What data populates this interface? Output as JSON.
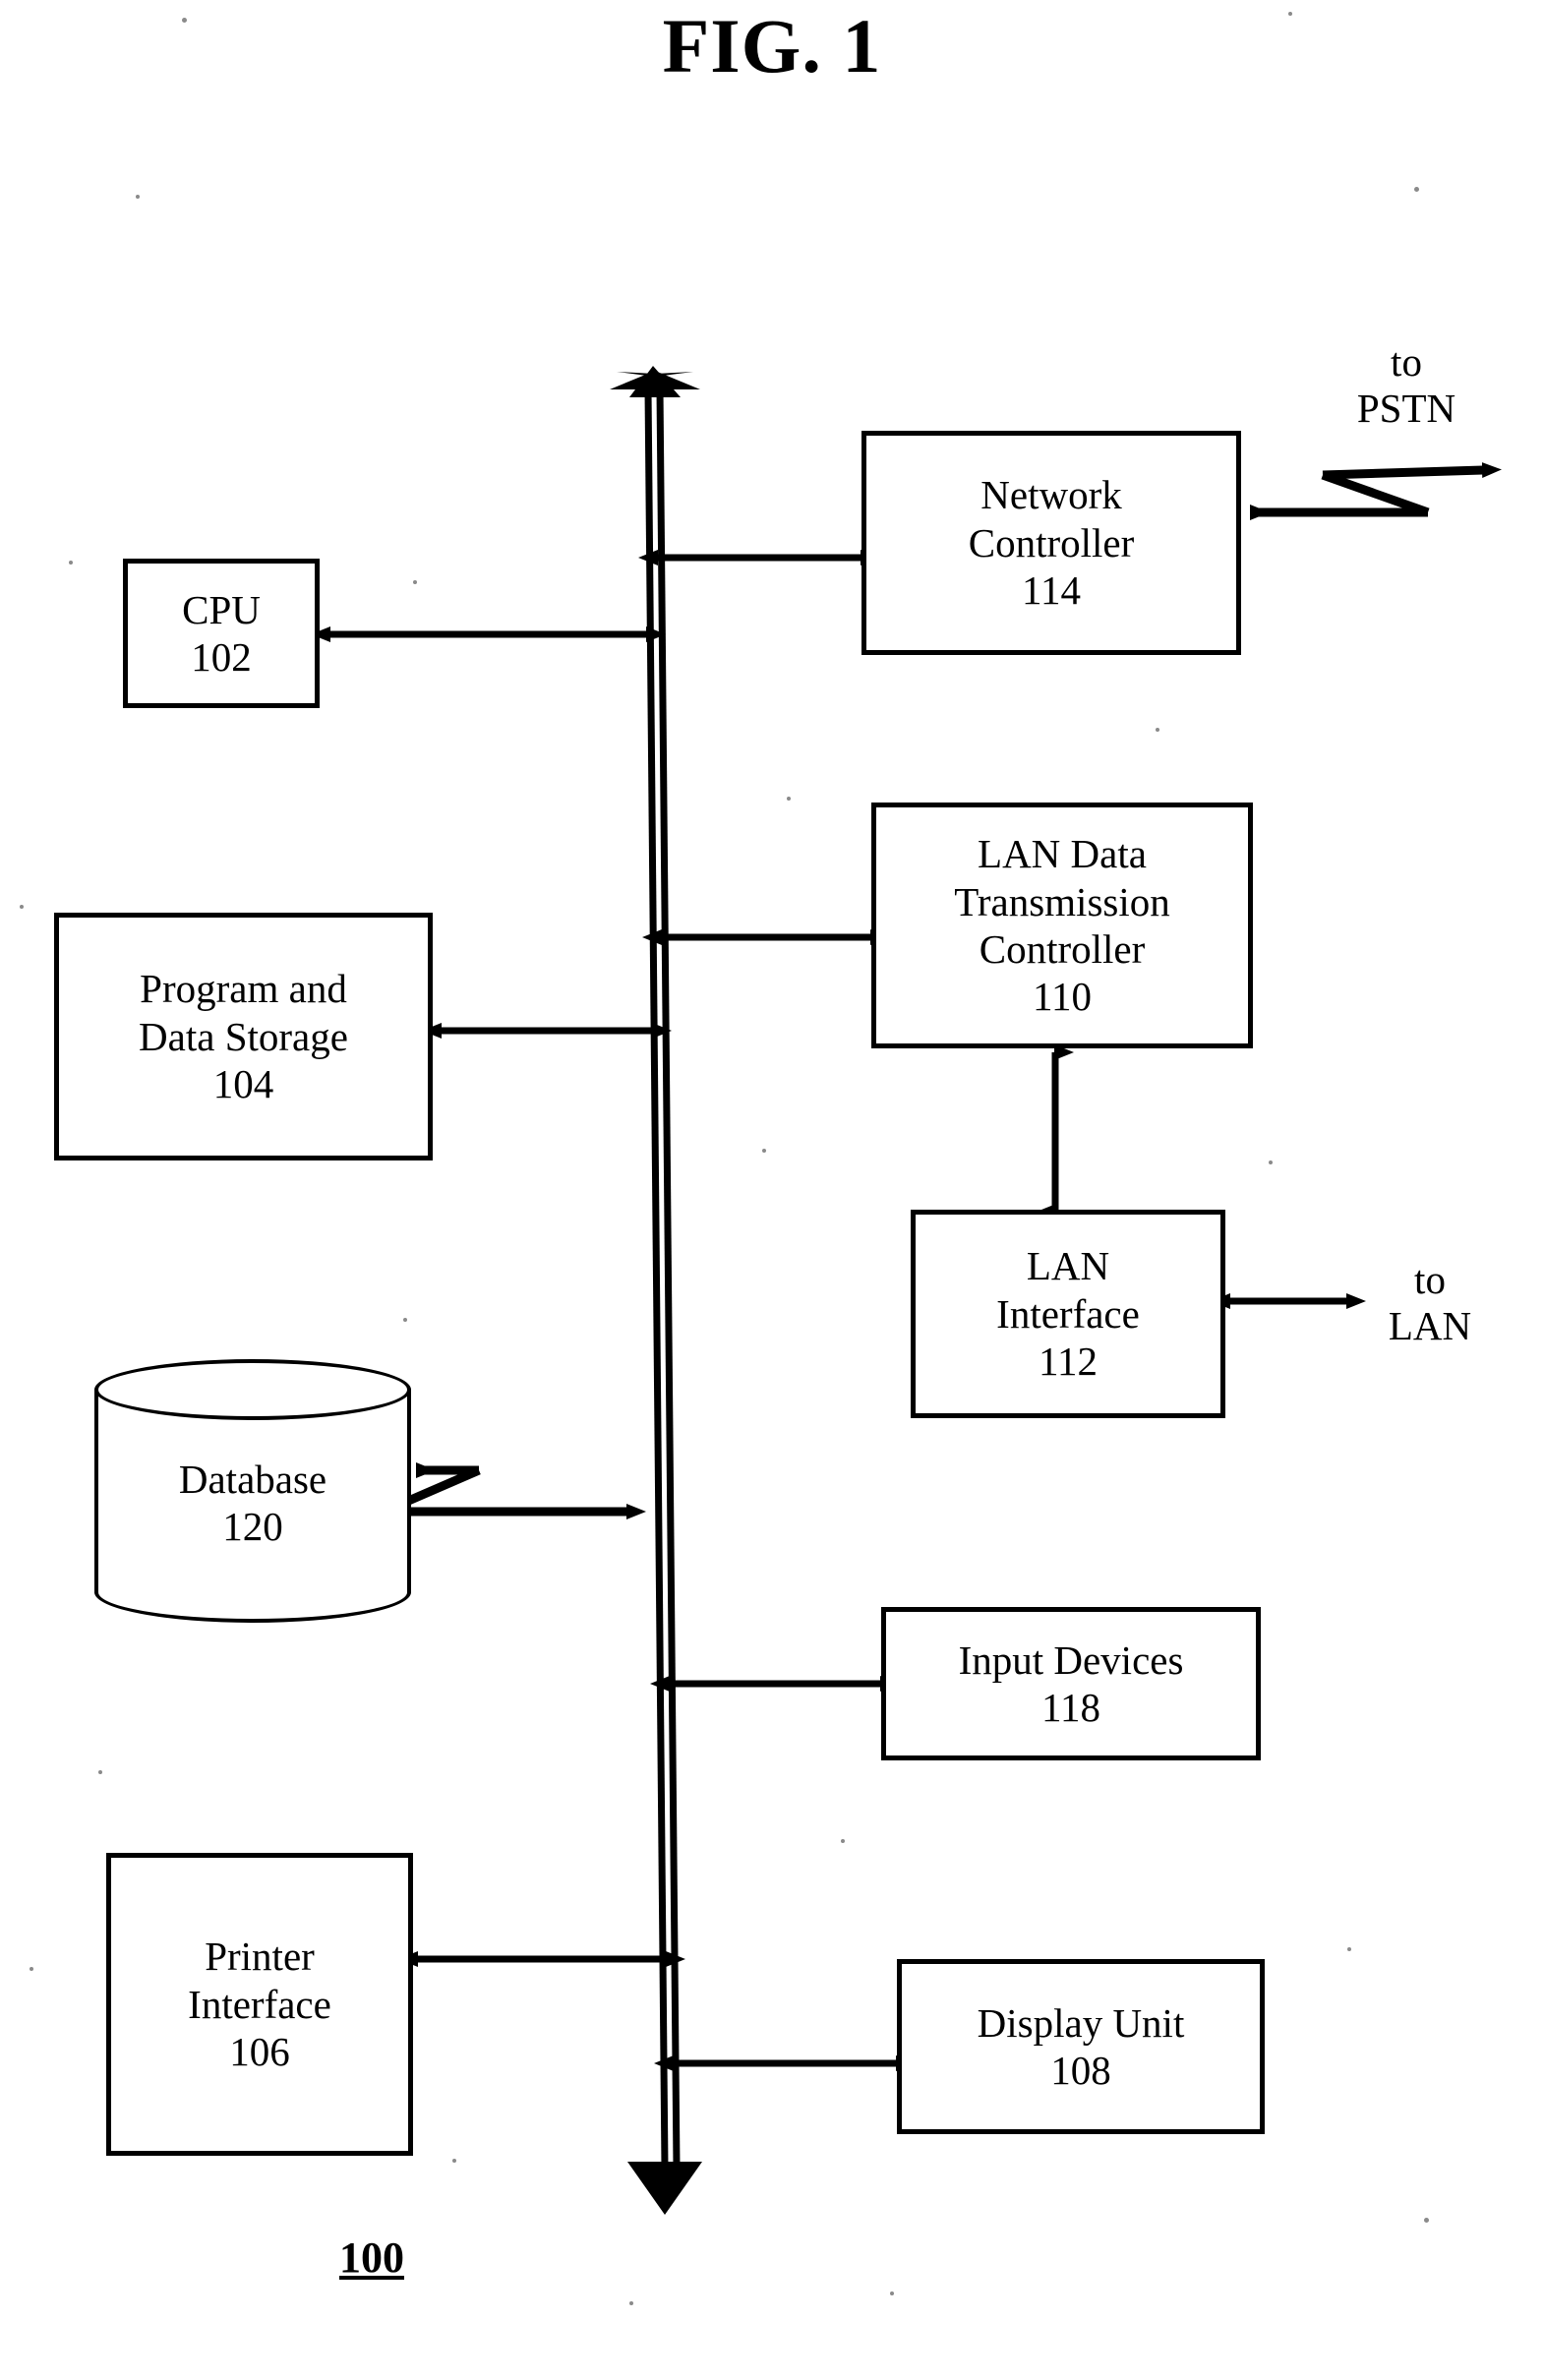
{
  "figure": {
    "title": "FIG. 1",
    "reference_numeral": "100"
  },
  "nodes": [
    {
      "id": "cpu",
      "lines": [
        "CPU",
        "102"
      ],
      "numeral": "102"
    },
    {
      "id": "storage",
      "lines": [
        "Program and",
        "Data Storage",
        "104"
      ],
      "numeral": "104"
    },
    {
      "id": "database",
      "lines": [
        "Database",
        "120"
      ],
      "numeral": "120"
    },
    {
      "id": "printer",
      "lines": [
        "Printer",
        "Interface",
        "106"
      ],
      "numeral": "106"
    },
    {
      "id": "network",
      "lines": [
        "Network",
        "Controller",
        "114"
      ],
      "numeral": "114"
    },
    {
      "id": "landata",
      "lines": [
        "LAN Data",
        "Transmission",
        "Controller",
        "110"
      ],
      "numeral": "110"
    },
    {
      "id": "laniface",
      "lines": [
        "LAN",
        "Interface",
        "112"
      ],
      "numeral": "112"
    },
    {
      "id": "input",
      "lines": [
        "Input Devices",
        "118"
      ],
      "numeral": "118"
    },
    {
      "id": "display",
      "lines": [
        "Display Unit",
        "108"
      ],
      "numeral": "108"
    }
  ],
  "external_labels": [
    {
      "id": "to_pstn",
      "lines": [
        "to",
        "PSTN"
      ]
    },
    {
      "id": "to_lan",
      "lines": [
        "to",
        "LAN"
      ]
    }
  ],
  "bus": {
    "name": "system-bus",
    "style": "double-line-bidirectional"
  },
  "colors": {
    "ink": "#000000",
    "paper": "#ffffff"
  }
}
